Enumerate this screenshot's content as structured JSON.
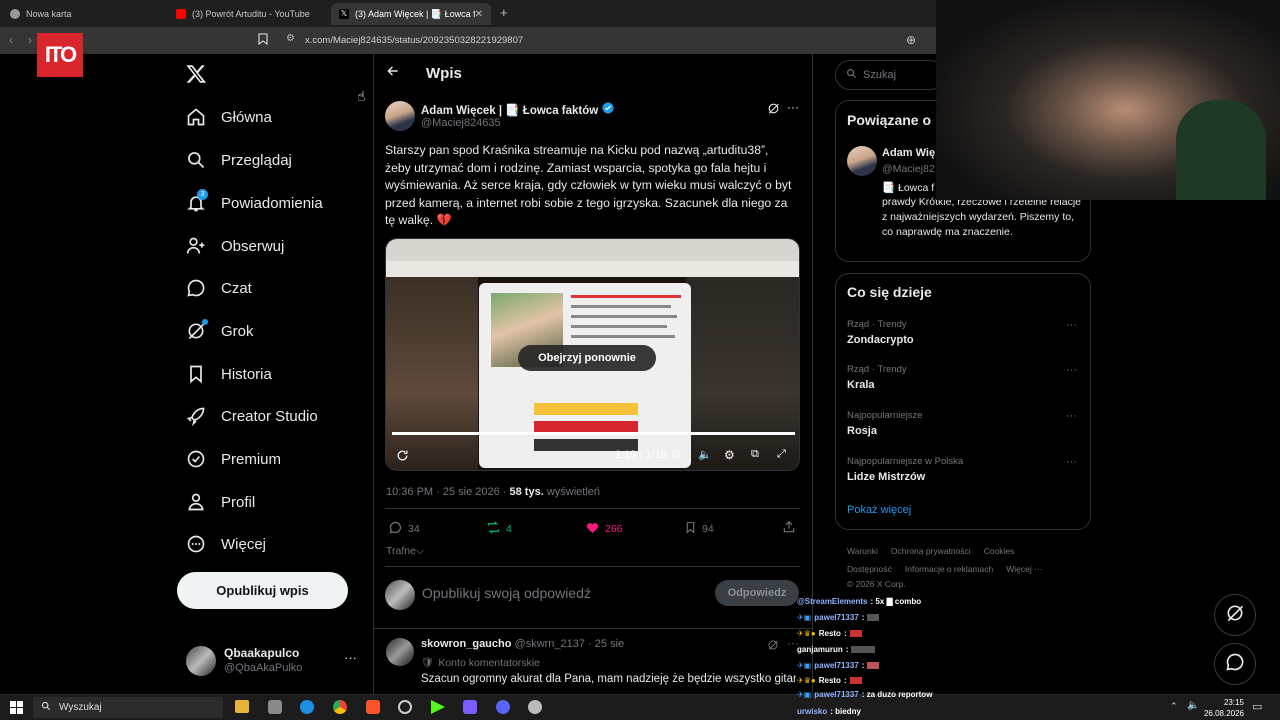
{
  "browser": {
    "tabs": [
      {
        "title": "Nowa karta",
        "color": "#bbbbbb"
      },
      {
        "title": "(3) Powrót Artuditu - YouTube",
        "color": "#ff0000"
      },
      {
        "title": "(3) Adam Więcek | 📑 Łowca fakt",
        "color": "#ffffff"
      }
    ],
    "url": "x.com/Maciej824635/status/2092350328221929807"
  },
  "overlay_logo": "ITO",
  "nav": {
    "items": [
      {
        "label": "Główna",
        "icon": "home-icon"
      },
      {
        "label": "Przeglądaj",
        "icon": "search-icon"
      },
      {
        "label": "Powiadomienia",
        "icon": "bell-icon",
        "badge": "3"
      },
      {
        "label": "Obserwuj",
        "icon": "person-add-icon"
      },
      {
        "label": "Czat",
        "icon": "chat-icon"
      },
      {
        "label": "Grok",
        "icon": "grok-icon"
      },
      {
        "label": "Historia",
        "icon": "bookmark-icon"
      },
      {
        "label": "Creator Studio",
        "icon": "rocket-icon"
      },
      {
        "label": "Premium",
        "icon": "verified-icon"
      },
      {
        "label": "Profil",
        "icon": "person-icon"
      },
      {
        "label": "Więcej",
        "icon": "more-circle-icon"
      }
    ],
    "post_button": "Opublikuj wpis",
    "account": {
      "name": "Qbaakapulco",
      "handle": "@QbaAkaPulko"
    }
  },
  "header": {
    "title": "Wpis"
  },
  "tweet": {
    "author": "Adam Więcek | 📑 Łowca faktów",
    "handle": "@Maciej824635",
    "text": "Starszy pan spod Kraśnika streamuje na Kicku pod nazwą „artuditu38”, żeby utrzymać dom i rodzinę. Zamiast wsparcia, spotyka go fala hejtu i wyśmiewania. Aż serce kraja, gdy człowiek w tym wieku musi walczyć o byt przed kamerą, a internet robi sobie z tego igrzyska. Szacunek dla niego za tę walkę. 💔",
    "video": {
      "replay_label": "Obejrzyj ponownie",
      "time": "1:19 / 1:19",
      "progress": 1.0
    },
    "meta": {
      "time": "10:36 PM · 25 sie 2026 · ",
      "views": "58 tys.",
      "views_label": " wyświetleń"
    },
    "stats": {
      "replies": "34",
      "reposts": "4",
      "likes": "266",
      "bookmarks": "94"
    },
    "sort_label": "Trafne",
    "reply_placeholder": "Opublikuj swoją odpowiedź",
    "reply_button": "Odpowiedz"
  },
  "comment": {
    "author": "skowron_gaucho",
    "handle": "@skwrn_2137 · 25 sie",
    "badge": "Konto komentatorskie",
    "text": "Szacun ogromny akurat dla Pana, mam nadzieję że będzie wszystko gitara"
  },
  "right": {
    "search_placeholder": "Szukaj",
    "related_title": "Powiązane o",
    "related_name": "Adam Wię",
    "related_handle": "@Maciej82",
    "related_bio_1": "📑 Łowca f",
    "related_bio_2": "prawdy Krótkie, rzeczowe i rzetelne relacje z najważniejszych wydarzeń. Piszemy to, co naprawdę ma znaczenie.",
    "trends_title": "Co się dzieje",
    "trends": [
      {
        "context": "Rząd · Trendy",
        "name": "Zondacrypto"
      },
      {
        "context": "Rząd · Trendy",
        "name": "Krala"
      },
      {
        "context": "Najpopularniejsze",
        "name": "Rosja"
      },
      {
        "context": "Najpopularniejsze w Polska",
        "name": "Lidze Mistrzów"
      }
    ],
    "show_more": "Pokaż więcej",
    "footer": [
      "Warunki",
      "Ochrona prywatności",
      "Cookies",
      "Dostępność",
      "Informacje o reklamach",
      "Więcej ···",
      "© 2026 X Corp."
    ]
  },
  "chat": [
    {
      "user": "@StreamElements",
      "msg": ": 5x ▇ combo"
    },
    {
      "user": "pawel71337",
      "msg": ":"
    },
    {
      "user": "Resto",
      "msg": ":"
    },
    {
      "user": "ganjamurun",
      "msg": ":"
    },
    {
      "user": "pawel71337",
      "msg": ":"
    },
    {
      "user": "Resto",
      "msg": ":"
    },
    {
      "user": "pawel71337",
      "msg": ": za duzo reportow"
    },
    {
      "user": "urwisko",
      "msg": ": biedny"
    }
  ],
  "taskbar": {
    "search": "Wyszukaj",
    "time": "23:15",
    "date": "26.08.2026"
  },
  "colors": {
    "accent": "#1d9bf0",
    "like": "#f91880",
    "repost": "#00ba7c"
  }
}
